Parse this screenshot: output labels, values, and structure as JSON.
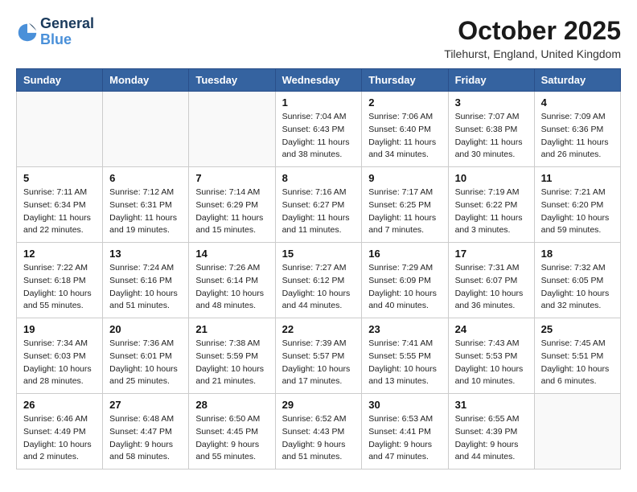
{
  "header": {
    "logo_line1": "General",
    "logo_line2": "Blue",
    "month_title": "October 2025",
    "location": "Tilehurst, England, United Kingdom"
  },
  "days_of_week": [
    "Sunday",
    "Monday",
    "Tuesday",
    "Wednesday",
    "Thursday",
    "Friday",
    "Saturday"
  ],
  "weeks": [
    [
      {
        "day": "",
        "sunrise": "",
        "sunset": "",
        "daylight": ""
      },
      {
        "day": "",
        "sunrise": "",
        "sunset": "",
        "daylight": ""
      },
      {
        "day": "",
        "sunrise": "",
        "sunset": "",
        "daylight": ""
      },
      {
        "day": "1",
        "sunrise": "Sunrise: 7:04 AM",
        "sunset": "Sunset: 6:43 PM",
        "daylight": "Daylight: 11 hours and 38 minutes."
      },
      {
        "day": "2",
        "sunrise": "Sunrise: 7:06 AM",
        "sunset": "Sunset: 6:40 PM",
        "daylight": "Daylight: 11 hours and 34 minutes."
      },
      {
        "day": "3",
        "sunrise": "Sunrise: 7:07 AM",
        "sunset": "Sunset: 6:38 PM",
        "daylight": "Daylight: 11 hours and 30 minutes."
      },
      {
        "day": "4",
        "sunrise": "Sunrise: 7:09 AM",
        "sunset": "Sunset: 6:36 PM",
        "daylight": "Daylight: 11 hours and 26 minutes."
      }
    ],
    [
      {
        "day": "5",
        "sunrise": "Sunrise: 7:11 AM",
        "sunset": "Sunset: 6:34 PM",
        "daylight": "Daylight: 11 hours and 22 minutes."
      },
      {
        "day": "6",
        "sunrise": "Sunrise: 7:12 AM",
        "sunset": "Sunset: 6:31 PM",
        "daylight": "Daylight: 11 hours and 19 minutes."
      },
      {
        "day": "7",
        "sunrise": "Sunrise: 7:14 AM",
        "sunset": "Sunset: 6:29 PM",
        "daylight": "Daylight: 11 hours and 15 minutes."
      },
      {
        "day": "8",
        "sunrise": "Sunrise: 7:16 AM",
        "sunset": "Sunset: 6:27 PM",
        "daylight": "Daylight: 11 hours and 11 minutes."
      },
      {
        "day": "9",
        "sunrise": "Sunrise: 7:17 AM",
        "sunset": "Sunset: 6:25 PM",
        "daylight": "Daylight: 11 hours and 7 minutes."
      },
      {
        "day": "10",
        "sunrise": "Sunrise: 7:19 AM",
        "sunset": "Sunset: 6:22 PM",
        "daylight": "Daylight: 11 hours and 3 minutes."
      },
      {
        "day": "11",
        "sunrise": "Sunrise: 7:21 AM",
        "sunset": "Sunset: 6:20 PM",
        "daylight": "Daylight: 10 hours and 59 minutes."
      }
    ],
    [
      {
        "day": "12",
        "sunrise": "Sunrise: 7:22 AM",
        "sunset": "Sunset: 6:18 PM",
        "daylight": "Daylight: 10 hours and 55 minutes."
      },
      {
        "day": "13",
        "sunrise": "Sunrise: 7:24 AM",
        "sunset": "Sunset: 6:16 PM",
        "daylight": "Daylight: 10 hours and 51 minutes."
      },
      {
        "day": "14",
        "sunrise": "Sunrise: 7:26 AM",
        "sunset": "Sunset: 6:14 PM",
        "daylight": "Daylight: 10 hours and 48 minutes."
      },
      {
        "day": "15",
        "sunrise": "Sunrise: 7:27 AM",
        "sunset": "Sunset: 6:12 PM",
        "daylight": "Daylight: 10 hours and 44 minutes."
      },
      {
        "day": "16",
        "sunrise": "Sunrise: 7:29 AM",
        "sunset": "Sunset: 6:09 PM",
        "daylight": "Daylight: 10 hours and 40 minutes."
      },
      {
        "day": "17",
        "sunrise": "Sunrise: 7:31 AM",
        "sunset": "Sunset: 6:07 PM",
        "daylight": "Daylight: 10 hours and 36 minutes."
      },
      {
        "day": "18",
        "sunrise": "Sunrise: 7:32 AM",
        "sunset": "Sunset: 6:05 PM",
        "daylight": "Daylight: 10 hours and 32 minutes."
      }
    ],
    [
      {
        "day": "19",
        "sunrise": "Sunrise: 7:34 AM",
        "sunset": "Sunset: 6:03 PM",
        "daylight": "Daylight: 10 hours and 28 minutes."
      },
      {
        "day": "20",
        "sunrise": "Sunrise: 7:36 AM",
        "sunset": "Sunset: 6:01 PM",
        "daylight": "Daylight: 10 hours and 25 minutes."
      },
      {
        "day": "21",
        "sunrise": "Sunrise: 7:38 AM",
        "sunset": "Sunset: 5:59 PM",
        "daylight": "Daylight: 10 hours and 21 minutes."
      },
      {
        "day": "22",
        "sunrise": "Sunrise: 7:39 AM",
        "sunset": "Sunset: 5:57 PM",
        "daylight": "Daylight: 10 hours and 17 minutes."
      },
      {
        "day": "23",
        "sunrise": "Sunrise: 7:41 AM",
        "sunset": "Sunset: 5:55 PM",
        "daylight": "Daylight: 10 hours and 13 minutes."
      },
      {
        "day": "24",
        "sunrise": "Sunrise: 7:43 AM",
        "sunset": "Sunset: 5:53 PM",
        "daylight": "Daylight: 10 hours and 10 minutes."
      },
      {
        "day": "25",
        "sunrise": "Sunrise: 7:45 AM",
        "sunset": "Sunset: 5:51 PM",
        "daylight": "Daylight: 10 hours and 6 minutes."
      }
    ],
    [
      {
        "day": "26",
        "sunrise": "Sunrise: 6:46 AM",
        "sunset": "Sunset: 4:49 PM",
        "daylight": "Daylight: 10 hours and 2 minutes."
      },
      {
        "day": "27",
        "sunrise": "Sunrise: 6:48 AM",
        "sunset": "Sunset: 4:47 PM",
        "daylight": "Daylight: 9 hours and 58 minutes."
      },
      {
        "day": "28",
        "sunrise": "Sunrise: 6:50 AM",
        "sunset": "Sunset: 4:45 PM",
        "daylight": "Daylight: 9 hours and 55 minutes."
      },
      {
        "day": "29",
        "sunrise": "Sunrise: 6:52 AM",
        "sunset": "Sunset: 4:43 PM",
        "daylight": "Daylight: 9 hours and 51 minutes."
      },
      {
        "day": "30",
        "sunrise": "Sunrise: 6:53 AM",
        "sunset": "Sunset: 4:41 PM",
        "daylight": "Daylight: 9 hours and 47 minutes."
      },
      {
        "day": "31",
        "sunrise": "Sunrise: 6:55 AM",
        "sunset": "Sunset: 4:39 PM",
        "daylight": "Daylight: 9 hours and 44 minutes."
      },
      {
        "day": "",
        "sunrise": "",
        "sunset": "",
        "daylight": ""
      }
    ]
  ]
}
